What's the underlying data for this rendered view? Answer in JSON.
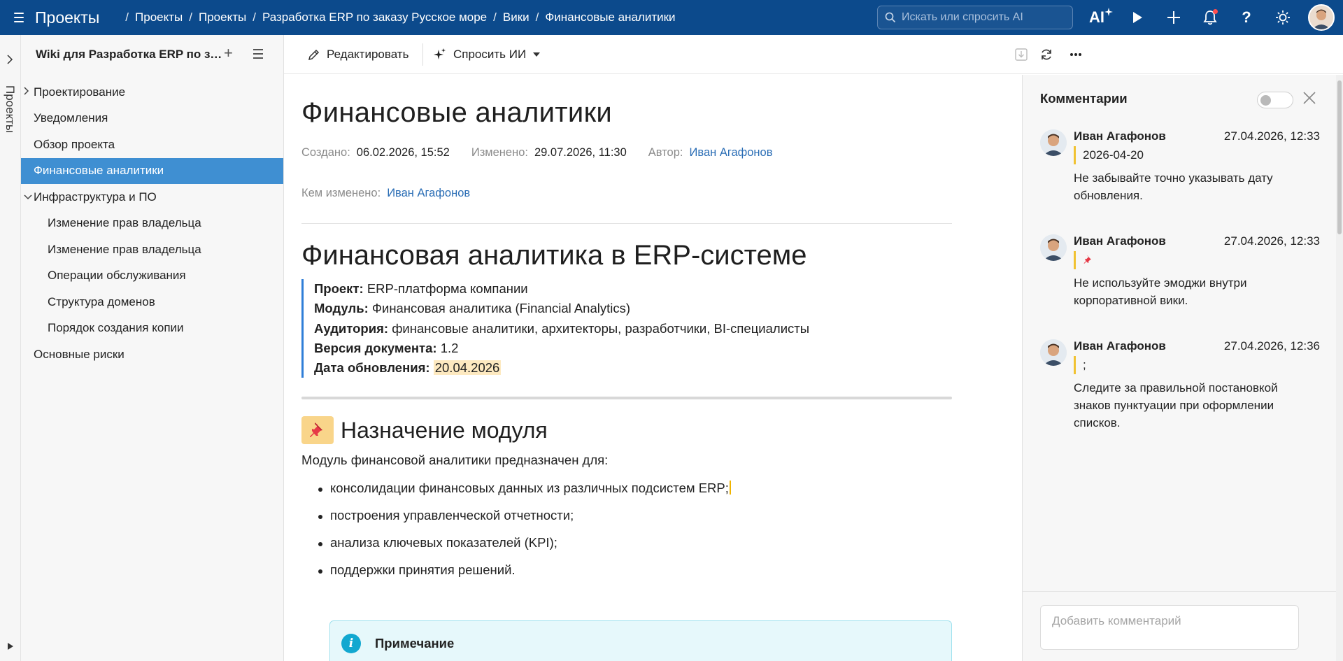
{
  "topbar": {
    "app_title": "Проекты",
    "breadcrumb": [
      "Проекты",
      "Проекты",
      "Разработка ERP по заказу Русское море",
      "Вики",
      "Финансовые аналитики"
    ],
    "search_placeholder": "Искать или спросить AI",
    "ai_label": "AI",
    "help_label": "?",
    "icons": [
      "hamburger-icon",
      "search-icon",
      "ai-sparkle-icon",
      "play-icon",
      "plus-icon",
      "bell-icon",
      "help-icon",
      "sun-icon",
      "user-avatar"
    ]
  },
  "rail": {
    "label": "Проекты"
  },
  "wiki": {
    "title": "Wiki для Разработка ERP по заказу Русское море",
    "tree": [
      {
        "label": "Проектирование",
        "level": 0,
        "chevron": "right",
        "active": false
      },
      {
        "label": "Уведомления",
        "level": 0,
        "chevron": "",
        "active": false
      },
      {
        "label": "Обзор проекта",
        "level": 0,
        "chevron": "",
        "active": false
      },
      {
        "label": "Финансовые аналитики",
        "level": 0,
        "chevron": "",
        "active": true
      },
      {
        "label": "Инфраструктура и ПО",
        "level": 0,
        "chevron": "down",
        "active": false
      },
      {
        "label": "Изменение прав владельца",
        "level": 1,
        "chevron": "",
        "active": false
      },
      {
        "label": "Изменение прав владельца",
        "level": 1,
        "chevron": "",
        "active": false
      },
      {
        "label": "Операции обслуживания",
        "level": 1,
        "chevron": "",
        "active": false
      },
      {
        "label": "Структура доменов",
        "level": 1,
        "chevron": "",
        "active": false
      },
      {
        "label": "Порядок создания копии",
        "level": 1,
        "chevron": "",
        "active": false
      },
      {
        "label": "Основные риски",
        "level": 0,
        "chevron": "",
        "active": false
      }
    ]
  },
  "toolbar": {
    "edit_label": "Редактировать",
    "ask_ai_label": "Спросить ИИ"
  },
  "page": {
    "title": "Финансовые аналитики",
    "meta": {
      "created_label": "Создано:",
      "created_value": "06.02.2026, 15:52",
      "modified_label": "Изменено:",
      "modified_value": "29.07.2026, 11:30",
      "author_label": "Автор:",
      "author_value": "Иван Агафонов",
      "modified_by_label": "Кем изменено:",
      "modified_by_value": "Иван Агафонов"
    },
    "heading1": "Финансовая аналитика в ERP-системе",
    "info": [
      {
        "label": "Проект:",
        "value": "ERP-платформа компании"
      },
      {
        "label": "Модуль:",
        "value": "Финансовая аналитика (Financial Analytics)"
      },
      {
        "label": "Аудитория:",
        "value": "финансовые аналитики, архитекторы, разработчики, BI-специалисты"
      },
      {
        "label": "Версия документа:",
        "value": "1.2"
      },
      {
        "label": "Дата обновления:",
        "value": "20.04.2026"
      }
    ],
    "heading2_emoji": "📌",
    "heading2": "Назначение модуля",
    "intro": "Модуль финансовой аналитики предназначен для:",
    "bullets": [
      "консолидации финансовых данных из различных подсистем ERP;",
      "построения управленческой отчетности;",
      "анализа ключевых показателей (KPI);",
      "поддержки принятия решений."
    ],
    "note_title": "Примечание"
  },
  "comments": {
    "title": "Комментарии",
    "input_placeholder": "Добавить комментарий",
    "items": [
      {
        "author": "Иван Агафонов",
        "date": "27.04.2026, 12:33",
        "quote": "2026-04-20",
        "text": "Не забывайте точно указывать дату обновления."
      },
      {
        "author": "Иван Агафонов",
        "date": "27.04.2026, 12:33",
        "quote": "📌",
        "text": "Не используйте эмоджи внутри корпоративной вики."
      },
      {
        "author": "Иван Агафонов",
        "date": "27.04.2026, 12:36",
        "quote": ";",
        "text": "Следите за правильной постановкой знаков пунктуации при оформлении списков."
      }
    ]
  },
  "colors": {
    "topbar": "#0c4a8c",
    "active_tree_item": "#3f8fd2",
    "link": "#2a6db5",
    "info_border": "#2f7ed8",
    "highlight": "#fde9c0",
    "quote_border": "#f1c232",
    "note_bg": "#e6f8fb"
  }
}
